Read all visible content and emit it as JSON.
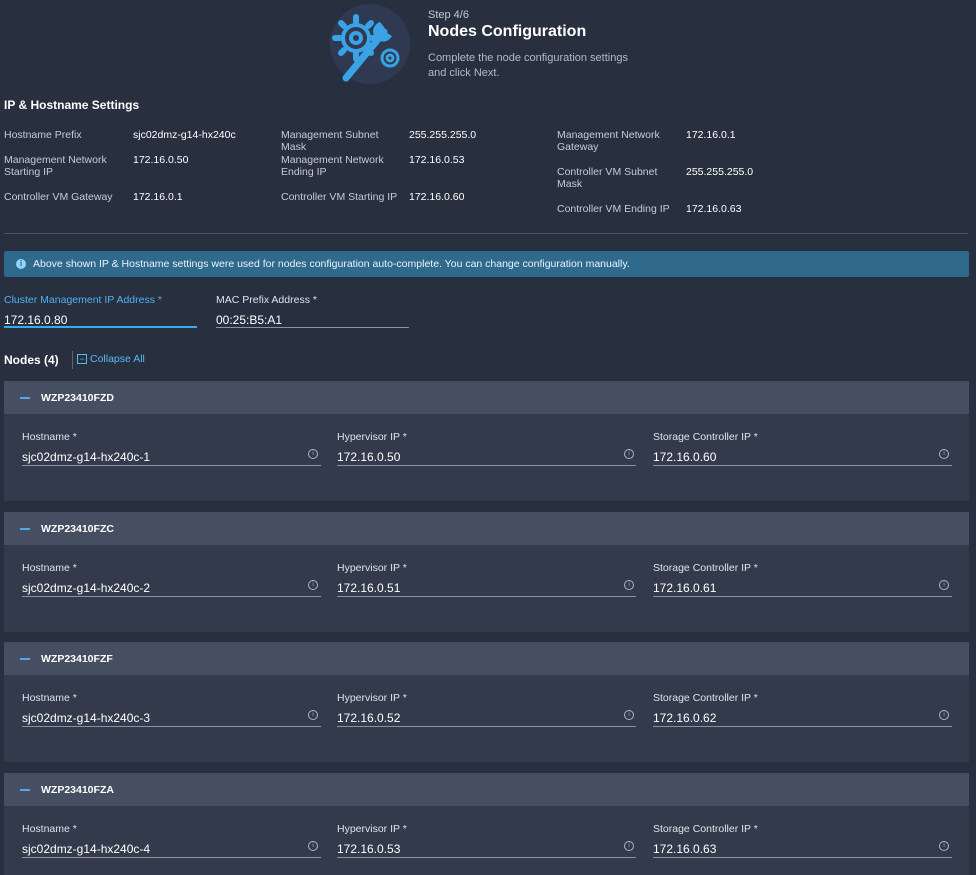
{
  "header": {
    "step": "Step 4/6",
    "title": "Nodes Configuration",
    "subtitle": "Complete the node configuration settings and click Next."
  },
  "ip_settings": {
    "title": "IP & Hostname Settings",
    "col1": [
      {
        "label": "Hostname Prefix",
        "value": "sjc02dmz-g14-hx240c"
      },
      {
        "label": "Management Network Starting IP",
        "value": "172.16.0.50"
      },
      {
        "label": "Controller VM Gateway",
        "value": "172.16.0.1"
      }
    ],
    "col2": [
      {
        "label": "Management Subnet Mask",
        "value": "255.255.255.0"
      },
      {
        "label": "Management Network Ending IP",
        "value": "172.16.0.53"
      },
      {
        "label": "Controller VM Starting IP",
        "value": "172.16.0.60"
      }
    ],
    "col3": [
      {
        "label": "Management Network Gateway",
        "value": "172.16.0.1"
      },
      {
        "label": "Controller VM Subnet Mask",
        "value": "255.255.255.0"
      },
      {
        "label": "Controller VM Ending IP",
        "value": "172.16.0.63"
      }
    ]
  },
  "banner": {
    "icon": "info-icon",
    "text": "Above shown IP & Hostname settings were used for nodes configuration auto-complete. You can change configuration manually."
  },
  "cluster": {
    "mgmt_ip_label": "Cluster Management IP Address *",
    "mgmt_ip_value": "172.16.0.80",
    "mac_prefix_label": "MAC Prefix Address *",
    "mac_prefix_value": "00:25:B5:A1"
  },
  "nodes_section": {
    "title": "Nodes (4)",
    "collapse_label": "Collapse All"
  },
  "field_labels": {
    "hostname": "Hostname *",
    "hypervisor_ip": "Hypervisor IP *",
    "storage_ip": "Storage Controller IP *"
  },
  "nodes": [
    {
      "id": "WZP23410FZD",
      "hostname": "sjc02dmz-g14-hx240c-1",
      "hypervisor_ip": "172.16.0.50",
      "storage_ip": "172.16.0.60"
    },
    {
      "id": "WZP23410FZC",
      "hostname": "sjc02dmz-g14-hx240c-2",
      "hypervisor_ip": "172.16.0.51",
      "storage_ip": "172.16.0.61"
    },
    {
      "id": "WZP23410FZF",
      "hostname": "sjc02dmz-g14-hx240c-3",
      "hypervisor_ip": "172.16.0.52",
      "storage_ip": "172.16.0.62"
    },
    {
      "id": "WZP23410FZA",
      "hostname": "sjc02dmz-g14-hx240c-4",
      "hypervisor_ip": "172.16.0.53",
      "storage_ip": "172.16.0.63"
    }
  ],
  "colors": {
    "background": "#282f3f",
    "accent": "#39a9f0",
    "banner": "#2f6a8c"
  }
}
